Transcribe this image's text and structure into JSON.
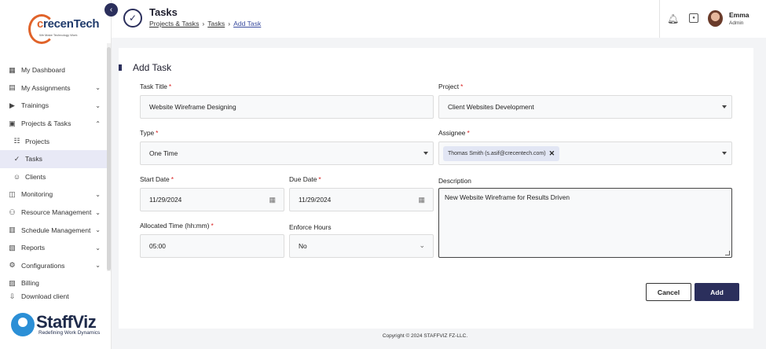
{
  "sidebar": {
    "logo_text": "recenTech",
    "logo_tagline": "We Make Technology Work",
    "items": [
      {
        "label": "My Dashboard",
        "icon": "dashboard-icon"
      },
      {
        "label": "My Assignments",
        "icon": "assignments-icon"
      },
      {
        "label": "Trainings",
        "icon": "training-icon"
      },
      {
        "label": "Projects & Tasks",
        "icon": "projects-tasks-icon"
      },
      {
        "label": "Projects",
        "icon": "projects-icon"
      },
      {
        "label": "Tasks",
        "icon": "tasks-icon"
      },
      {
        "label": "Clients",
        "icon": "clients-icon"
      },
      {
        "label": "Monitoring",
        "icon": "monitoring-icon"
      },
      {
        "label": "Resource Management",
        "icon": "resource-icon"
      },
      {
        "label": "Schedule Management",
        "icon": "schedule-icon"
      },
      {
        "label": "Reports",
        "icon": "reports-icon"
      },
      {
        "label": "Configurations",
        "icon": "config-icon"
      },
      {
        "label": "Billing",
        "icon": "billing-icon"
      },
      {
        "label": "Download client",
        "icon": "download-icon"
      }
    ],
    "brand_name": "StaffViz",
    "brand_tagline": "Redefining Work Dynamics"
  },
  "header": {
    "title": "Tasks",
    "breadcrumb": [
      "Projects & Tasks",
      "Tasks",
      "Add Task"
    ],
    "user_name": "Emma",
    "user_role": "Admin"
  },
  "form": {
    "heading": "Add Task",
    "task_title_label": "Task Title",
    "task_title_value": "Website Wireframe Designing",
    "project_label": "Project",
    "project_value": "Client Websites Development",
    "type_label": "Type",
    "type_value": "One Time",
    "assignee_label": "Assignee",
    "assignee_chip": "Thomas Smith (s.asif@crecentech.com)",
    "start_date_label": "Start Date",
    "start_date_value": "11/29/2024",
    "due_date_label": "Due Date",
    "due_date_value": "11/29/2024",
    "description_label": "Description",
    "description_value": "New Website Wireframe for Results Driven",
    "allocated_label": "Allocated Time (hh:mm)",
    "allocated_value": "05:00",
    "enforce_label": "Enforce Hours",
    "enforce_value": "No",
    "required_mark": "*",
    "cancel_label": "Cancel",
    "add_label": "Add"
  },
  "footer": {
    "copyright": "Copyright © 2024 STAFFVIZ FZ-LLC."
  },
  "colors": {
    "primary": "#2b2f5c",
    "required": "#d92020",
    "active_bg": "#e8e9f6"
  }
}
